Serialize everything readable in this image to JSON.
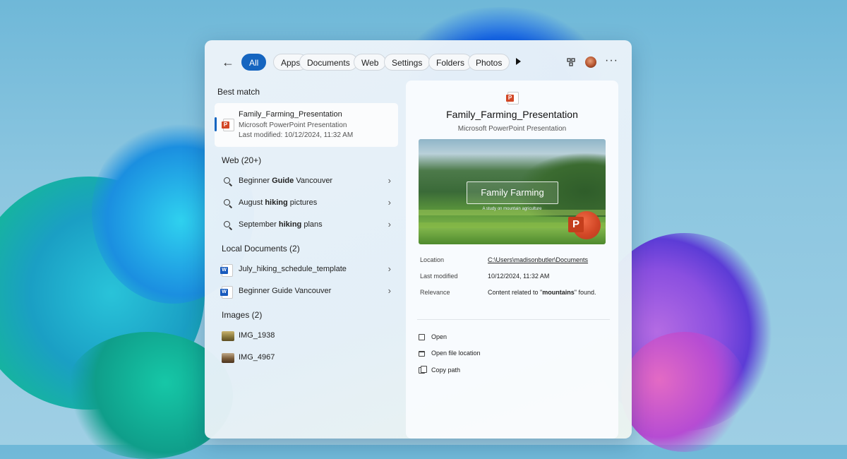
{
  "filters": {
    "back_label": "←",
    "items": [
      "All",
      "Apps",
      "Documents",
      "Web",
      "Settings",
      "Folders",
      "Photos"
    ],
    "active": "All",
    "more_label": "···"
  },
  "results": {
    "best_match_heading": "Best match",
    "best_match": {
      "title": "Family_Farming_Presentation",
      "type": "Microsoft PowerPoint Presentation",
      "modified": "Last modified: 10/12/2024, 11:32 AM"
    },
    "web_heading": "Web (20+)",
    "web": [
      {
        "pre": "Beginner ",
        "bold": "Guide",
        "post": " Vancouver"
      },
      {
        "pre": "August ",
        "bold": "hiking",
        "post": " pictures"
      },
      {
        "pre": "September ",
        "bold": "hiking",
        "post": " plans"
      }
    ],
    "docs_heading": "Local Documents (2)",
    "docs": [
      "July_hiking_schedule_template",
      "Beginner Guide Vancouver"
    ],
    "images_heading": "Images (2)",
    "images": [
      "IMG_1938",
      "IMG_4967"
    ]
  },
  "detail": {
    "title": "Family_Farming_Presentation",
    "subtitle": "Microsoft PowerPoint Presentation",
    "preview_title": "Family Farming",
    "preview_caption": "A study on mountain agriculture",
    "location_label": "Location",
    "location_value": "C:\\Users\\madisonbutler\\Documents",
    "modified_label": "Last modified",
    "modified_value": "10/12/2024, 11:32 AM",
    "relevance_label": "Relevance",
    "relevance_pre": "Content related to \"",
    "relevance_bold": "mountains",
    "relevance_post": "\" found.",
    "actions": [
      "Open",
      "Open file location",
      "Copy path"
    ]
  },
  "colors": {
    "accent": "#1565c0",
    "powerpoint": "#d24726",
    "word": "#185abd"
  }
}
